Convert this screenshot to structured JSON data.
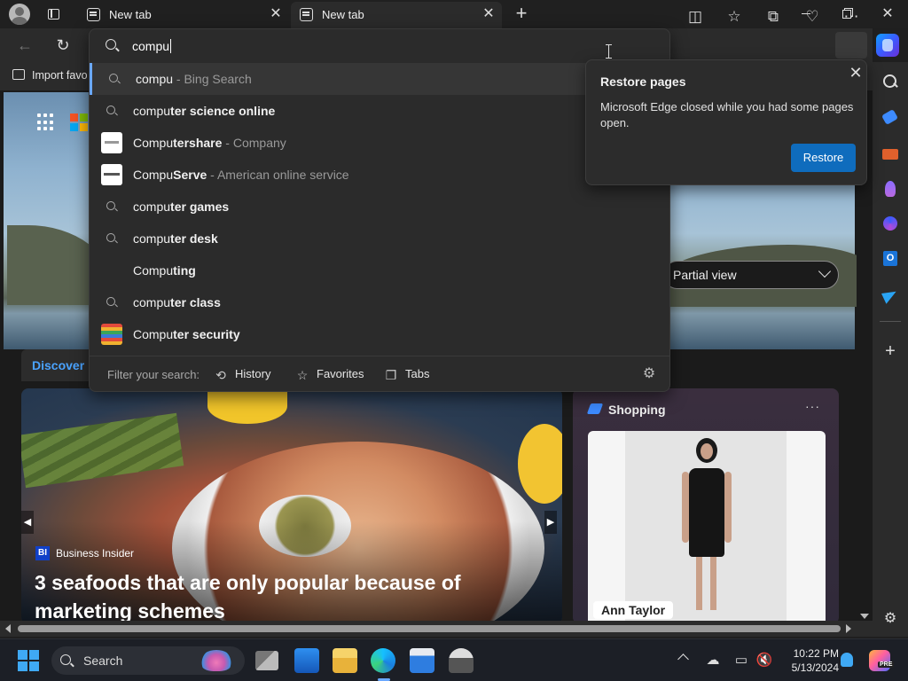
{
  "tabs": [
    {
      "title": "New tab"
    },
    {
      "title": "New tab"
    }
  ],
  "favorites_bar": {
    "import_label": "Import favo"
  },
  "address_bar": {
    "value": "compu"
  },
  "suggestions": [
    {
      "prefix": "compu",
      "bold": "",
      "suffix": " - Bing Search",
      "icon": "search-icon"
    },
    {
      "prefix": "compu",
      "bold": "ter science online",
      "suffix": "",
      "icon": "search-icon"
    },
    {
      "prefix": "Compu",
      "bold": "tershare",
      "suffix": " - Company",
      "icon": "computershare-logo"
    },
    {
      "prefix": "Compu",
      "bold": "Serve",
      "suffix": " - American online service",
      "icon": "compuserve-logo"
    },
    {
      "prefix": "compu",
      "bold": "ter games",
      "suffix": "",
      "icon": "search-icon"
    },
    {
      "prefix": "compu",
      "bold": "ter desk",
      "suffix": "",
      "icon": "search-icon"
    },
    {
      "prefix": "Compu",
      "bold": "ting",
      "suffix": "",
      "icon": "none"
    },
    {
      "prefix": "compu",
      "bold": "ter class",
      "suffix": "",
      "icon": "search-icon"
    },
    {
      "prefix": "Compu",
      "bold": "ter security",
      "suffix": "",
      "icon": "computer-security-logo"
    }
  ],
  "filter": {
    "label": "Filter your search:",
    "history": "History",
    "favorites": "Favorites",
    "tabs": "Tabs"
  },
  "restore_popup": {
    "title": "Restore pages",
    "message": "Microsoft Edge closed while you had some pages open.",
    "button": "Restore"
  },
  "feed": {
    "discover_tab": "Discover",
    "view_select": "Partial view",
    "news": {
      "source_badge": "BI",
      "source": "Business Insider",
      "headline": "3 seafoods that are only popular because of marketing schemes"
    },
    "shopping": {
      "title": "Shopping",
      "more": "···",
      "product_brand": "Ann Taylor"
    }
  },
  "taskbar": {
    "search_label": "Search",
    "time": "10:22 PM",
    "date": "5/13/2024",
    "copilot_badge": "PRE"
  },
  "colors": {
    "accent": "#0f6cbd",
    "link": "#4aa3ff"
  }
}
